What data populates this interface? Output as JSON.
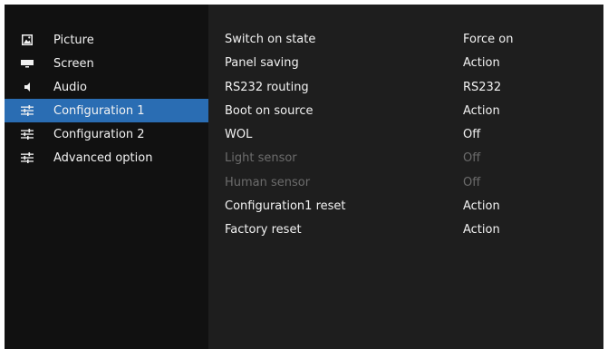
{
  "sidebar": {
    "items": [
      {
        "label": "Picture",
        "icon": "picture-icon"
      },
      {
        "label": "Screen",
        "icon": "screen-icon"
      },
      {
        "label": "Audio",
        "icon": "speaker-icon"
      },
      {
        "label": "Configuration 1",
        "icon": "sliders-icon",
        "active": true
      },
      {
        "label": "Configuration 2",
        "icon": "sliders-icon"
      },
      {
        "label": "Advanced option",
        "icon": "sliders-icon"
      }
    ]
  },
  "settings": {
    "rows": [
      {
        "label": "Switch on state",
        "value": "Force on",
        "enabled": true
      },
      {
        "label": "Panel saving",
        "value": "Action",
        "enabled": true
      },
      {
        "label": "RS232 routing",
        "value": "RS232",
        "enabled": true
      },
      {
        "label": "Boot on source",
        "value": "Action",
        "enabled": true
      },
      {
        "label": "WOL",
        "value": "Off",
        "enabled": true
      },
      {
        "label": "Light sensor",
        "value": "Off",
        "enabled": false
      },
      {
        "label": "Human sensor",
        "value": "Off",
        "enabled": false
      },
      {
        "label": "Configuration1 reset",
        "value": "Action",
        "enabled": true
      },
      {
        "label": "Factory reset",
        "value": "Action",
        "enabled": true
      }
    ]
  },
  "colors": {
    "highlight": "#2a6db3",
    "text": "#f2f2f2",
    "disabled_text": "#6c6c6c",
    "sidebar_bg": "#111111",
    "panel_bg": "#1e1e1e"
  }
}
